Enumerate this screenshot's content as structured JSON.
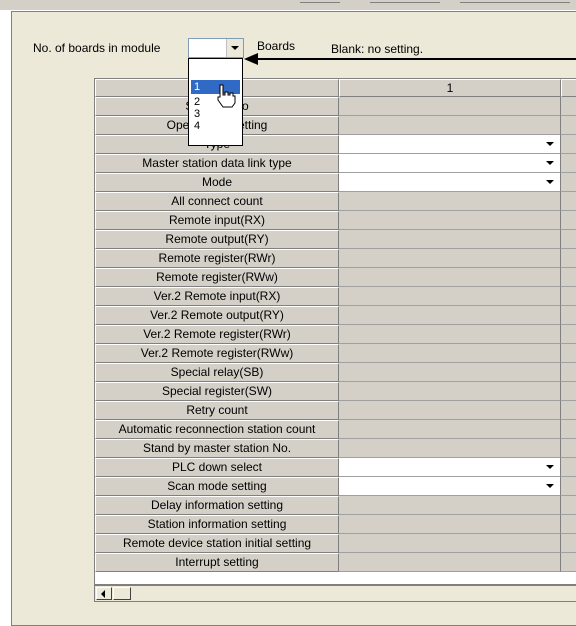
{
  "header": {
    "boards_label": "No. of boards in module",
    "boards_value": "",
    "boards_unit": "Boards",
    "blank_note": "Blank: no setting."
  },
  "dropdown": {
    "options": [
      "1",
      "2",
      "3",
      "4"
    ],
    "selected": "1"
  },
  "grid": {
    "column_header": "1",
    "rows": [
      {
        "label": "Start I/O No",
        "dropdown": false
      },
      {
        "label": "Operational setting",
        "dropdown": false
      },
      {
        "label": "Type",
        "dropdown": true
      },
      {
        "label": "Master station data link type",
        "dropdown": true
      },
      {
        "label": "Mode",
        "dropdown": true
      },
      {
        "label": "All connect count",
        "dropdown": false
      },
      {
        "label": "Remote input(RX)",
        "dropdown": false
      },
      {
        "label": "Remote output(RY)",
        "dropdown": false
      },
      {
        "label": "Remote register(RWr)",
        "dropdown": false
      },
      {
        "label": "Remote register(RWw)",
        "dropdown": false
      },
      {
        "label": "Ver.2 Remote input(RX)",
        "dropdown": false
      },
      {
        "label": "Ver.2 Remote output(RY)",
        "dropdown": false
      },
      {
        "label": "Ver.2 Remote register(RWr)",
        "dropdown": false
      },
      {
        "label": "Ver.2 Remote register(RWw)",
        "dropdown": false
      },
      {
        "label": "Special relay(SB)",
        "dropdown": false
      },
      {
        "label": "Special register(SW)",
        "dropdown": false
      },
      {
        "label": "Retry count",
        "dropdown": false
      },
      {
        "label": "Automatic reconnection station count",
        "dropdown": false
      },
      {
        "label": "Stand by master station No.",
        "dropdown": false
      },
      {
        "label": "PLC down select",
        "dropdown": true
      },
      {
        "label": "Scan mode setting",
        "dropdown": true
      },
      {
        "label": "Delay information setting",
        "dropdown": false
      },
      {
        "label": "Station information setting",
        "dropdown": false
      },
      {
        "label": "Remote device station initial setting",
        "dropdown": false
      },
      {
        "label": "Interrupt setting",
        "dropdown": false
      }
    ]
  },
  "colors": {
    "selection": "#316ac5",
    "header_gray": "#d4d0c8",
    "panel_bg": "#ece9d8"
  }
}
